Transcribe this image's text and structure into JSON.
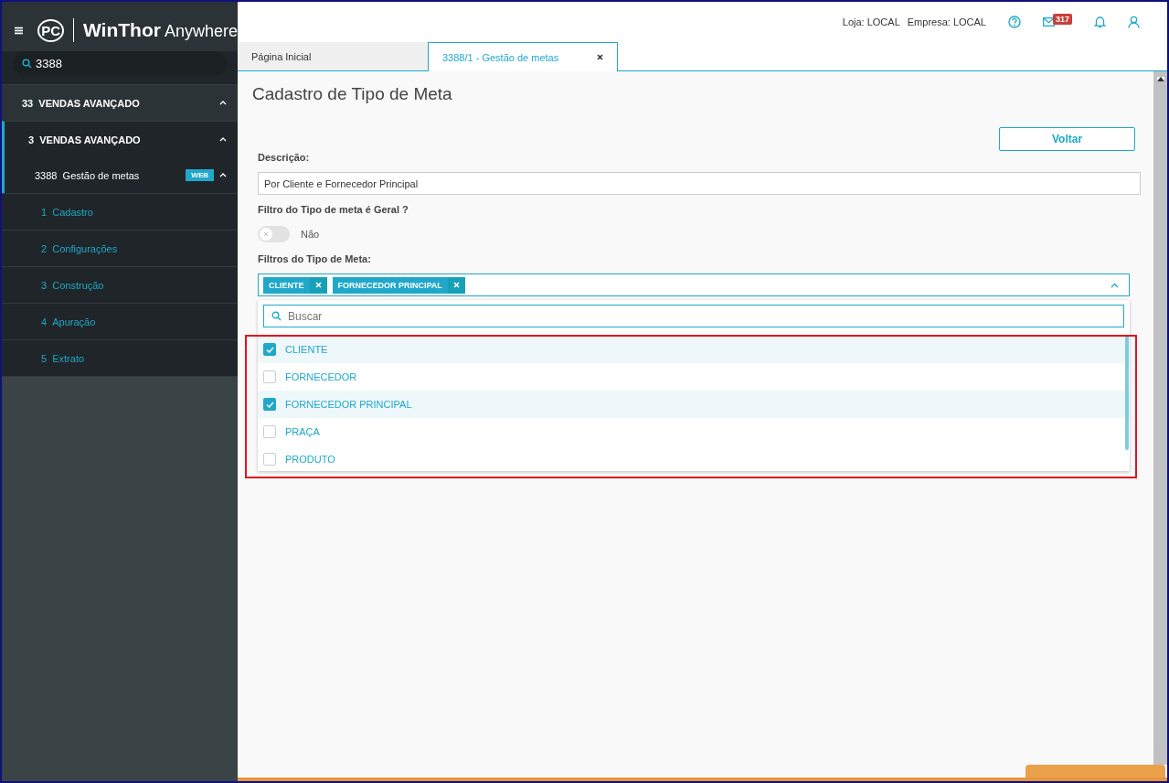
{
  "sidebar": {
    "logo_text": "WinThor",
    "logo_suffix": "Anywhere",
    "logo_badge": "PC",
    "search": {
      "value": "3388"
    },
    "items": [
      {
        "code": "33",
        "label": "VENDAS AVANÇADO",
        "expanded": true,
        "children": [
          {
            "code": "3",
            "label": "VENDAS AVANÇADO",
            "expanded": true,
            "children": [
              {
                "code": "3388",
                "label": "Gestão de metas",
                "badge": "WEB",
                "expanded": true,
                "children": [
                  {
                    "code": "1",
                    "label": "Cadastro"
                  },
                  {
                    "code": "2",
                    "label": "Configurações"
                  },
                  {
                    "code": "3",
                    "label": "Construção"
                  },
                  {
                    "code": "4",
                    "label": "Apuração"
                  },
                  {
                    "code": "5",
                    "label": "Extrato"
                  }
                ]
              }
            ]
          }
        ]
      }
    ]
  },
  "header": {
    "loja": "Loja: LOCAL",
    "empresa": "Empresa: LOCAL",
    "mail_count": "317"
  },
  "tabs": [
    {
      "label": "Página Inicial",
      "selected": false,
      "closable": false
    },
    {
      "label": "3388/1 - Gestão de metas",
      "selected": true,
      "closable": true
    }
  ],
  "page": {
    "title": "Cadastro de Tipo de Meta",
    "back_button": "Voltar",
    "description": {
      "label": "Descrição:",
      "value": "Por Cliente e Fornecedor Principal"
    },
    "general_filter": {
      "label": "Filtro do Tipo de meta é Geral ?",
      "on": false,
      "state_text": "Não"
    },
    "filters": {
      "label": "Filtros do Tipo de Meta:",
      "expanded": true,
      "tags": [
        "CLIENTE",
        "FORNECEDOR PRINCIPAL"
      ],
      "search_placeholder": "Buscar",
      "options": [
        {
          "label": "CLIENTE",
          "checked": true
        },
        {
          "label": "FORNECEDOR",
          "checked": false
        },
        {
          "label": "FORNECEDOR PRINCIPAL",
          "checked": true
        },
        {
          "label": "PRAÇA",
          "checked": false
        },
        {
          "label": "PRODUTO",
          "checked": false
        }
      ]
    }
  }
}
